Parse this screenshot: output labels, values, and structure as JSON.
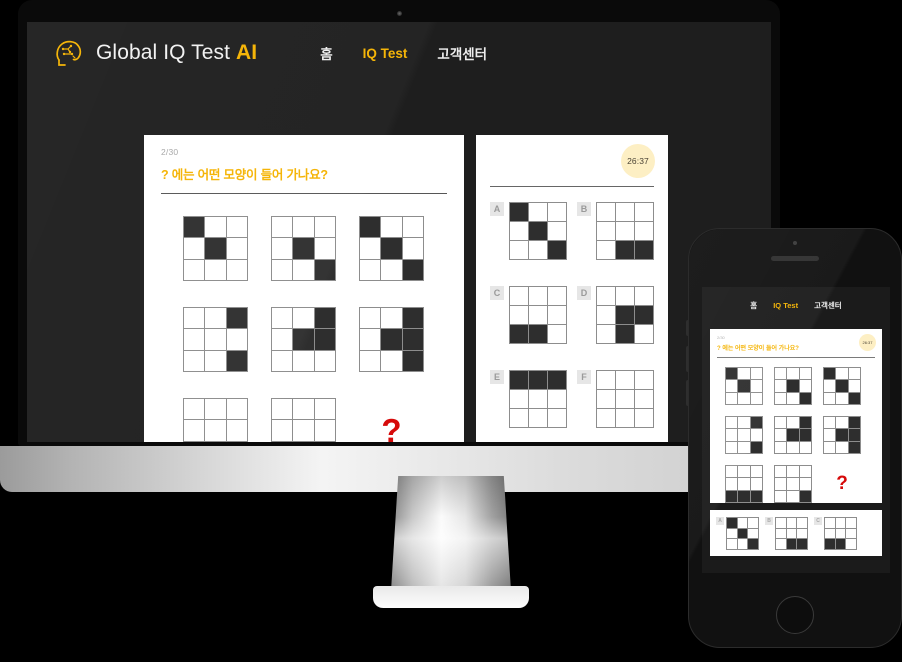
{
  "brand": {
    "name": "Global IQ Test",
    "suffix": "AI",
    "logo_icon": "brain-head-icon"
  },
  "nav": {
    "items": [
      {
        "label": "홈",
        "active": false
      },
      {
        "label": "IQ Test",
        "active": true
      },
      {
        "label": "고객센터",
        "active": false
      }
    ]
  },
  "quiz": {
    "counter": "2/30",
    "question": "? 에는 어떤 모양이 들어 가나요?",
    "timer": "26:37",
    "qmark": "?",
    "accent_color": "#f5b301",
    "qmark_color": "#d60a0a",
    "timer_bg": "#fdefc4",
    "matrix": [
      {
        "cells": [
          1,
          0,
          0,
          0,
          1,
          0,
          0,
          0,
          0
        ]
      },
      {
        "cells": [
          0,
          0,
          0,
          0,
          1,
          0,
          0,
          0,
          1
        ]
      },
      {
        "cells": [
          1,
          0,
          0,
          0,
          1,
          0,
          0,
          0,
          1
        ]
      },
      {
        "cells": [
          0,
          0,
          1,
          0,
          0,
          0,
          0,
          0,
          1
        ]
      },
      {
        "cells": [
          0,
          0,
          1,
          0,
          1,
          1,
          0,
          0,
          0
        ]
      },
      {
        "cells": [
          0,
          0,
          1,
          0,
          1,
          1,
          0,
          0,
          1
        ]
      },
      {
        "cells": [
          0,
          0,
          0,
          0,
          0,
          0,
          1,
          1,
          1
        ]
      },
      {
        "cells": [
          0,
          0,
          0,
          0,
          0,
          0,
          0,
          0,
          1
        ]
      }
    ],
    "answers": [
      {
        "label": "A",
        "cells": [
          1,
          0,
          0,
          0,
          1,
          0,
          0,
          0,
          1
        ]
      },
      {
        "label": "B",
        "cells": [
          0,
          0,
          0,
          0,
          0,
          0,
          0,
          1,
          1
        ]
      },
      {
        "label": "C",
        "cells": [
          0,
          0,
          0,
          0,
          0,
          0,
          1,
          1,
          0
        ]
      },
      {
        "label": "D",
        "cells": [
          0,
          0,
          0,
          0,
          1,
          1,
          0,
          1,
          0
        ]
      },
      {
        "label": "E",
        "cells": [
          1,
          1,
          1,
          0,
          0,
          0,
          0,
          0,
          0
        ]
      },
      {
        "label": "F",
        "cells": [
          0,
          0,
          0,
          0,
          0,
          0,
          0,
          0,
          0
        ]
      }
    ]
  },
  "phone": {
    "nav": {
      "items": [
        {
          "label": "홈",
          "active": false
        },
        {
          "label": "IQ Test",
          "active": true
        },
        {
          "label": "고객센터",
          "active": false
        }
      ]
    },
    "quiz": {
      "counter": "2/30",
      "question": "? 에는 어떤 모양이 들어 가나요?",
      "timer": "26:37",
      "qmark": "?",
      "matrix": [
        {
          "cells": [
            1,
            0,
            0,
            0,
            1,
            0,
            0,
            0,
            0
          ]
        },
        {
          "cells": [
            0,
            0,
            0,
            0,
            1,
            0,
            0,
            0,
            1
          ]
        },
        {
          "cells": [
            1,
            0,
            0,
            0,
            1,
            0,
            0,
            0,
            1
          ]
        },
        {
          "cells": [
            0,
            0,
            1,
            0,
            0,
            0,
            0,
            0,
            1
          ]
        },
        {
          "cells": [
            0,
            0,
            1,
            0,
            1,
            1,
            0,
            0,
            0
          ]
        },
        {
          "cells": [
            0,
            0,
            1,
            0,
            1,
            1,
            0,
            0,
            1
          ]
        },
        {
          "cells": [
            0,
            0,
            0,
            0,
            0,
            0,
            1,
            1,
            1
          ]
        },
        {
          "cells": [
            0,
            0,
            0,
            0,
            0,
            0,
            0,
            0,
            1
          ]
        }
      ],
      "answers": [
        {
          "label": "A",
          "cells": [
            1,
            0,
            0,
            0,
            1,
            0,
            0,
            0,
            1
          ]
        },
        {
          "label": "B",
          "cells": [
            0,
            0,
            0,
            0,
            0,
            0,
            0,
            1,
            1
          ]
        },
        {
          "label": "C",
          "cells": [
            0,
            0,
            0,
            0,
            0,
            0,
            1,
            1,
            0
          ]
        }
      ]
    }
  }
}
